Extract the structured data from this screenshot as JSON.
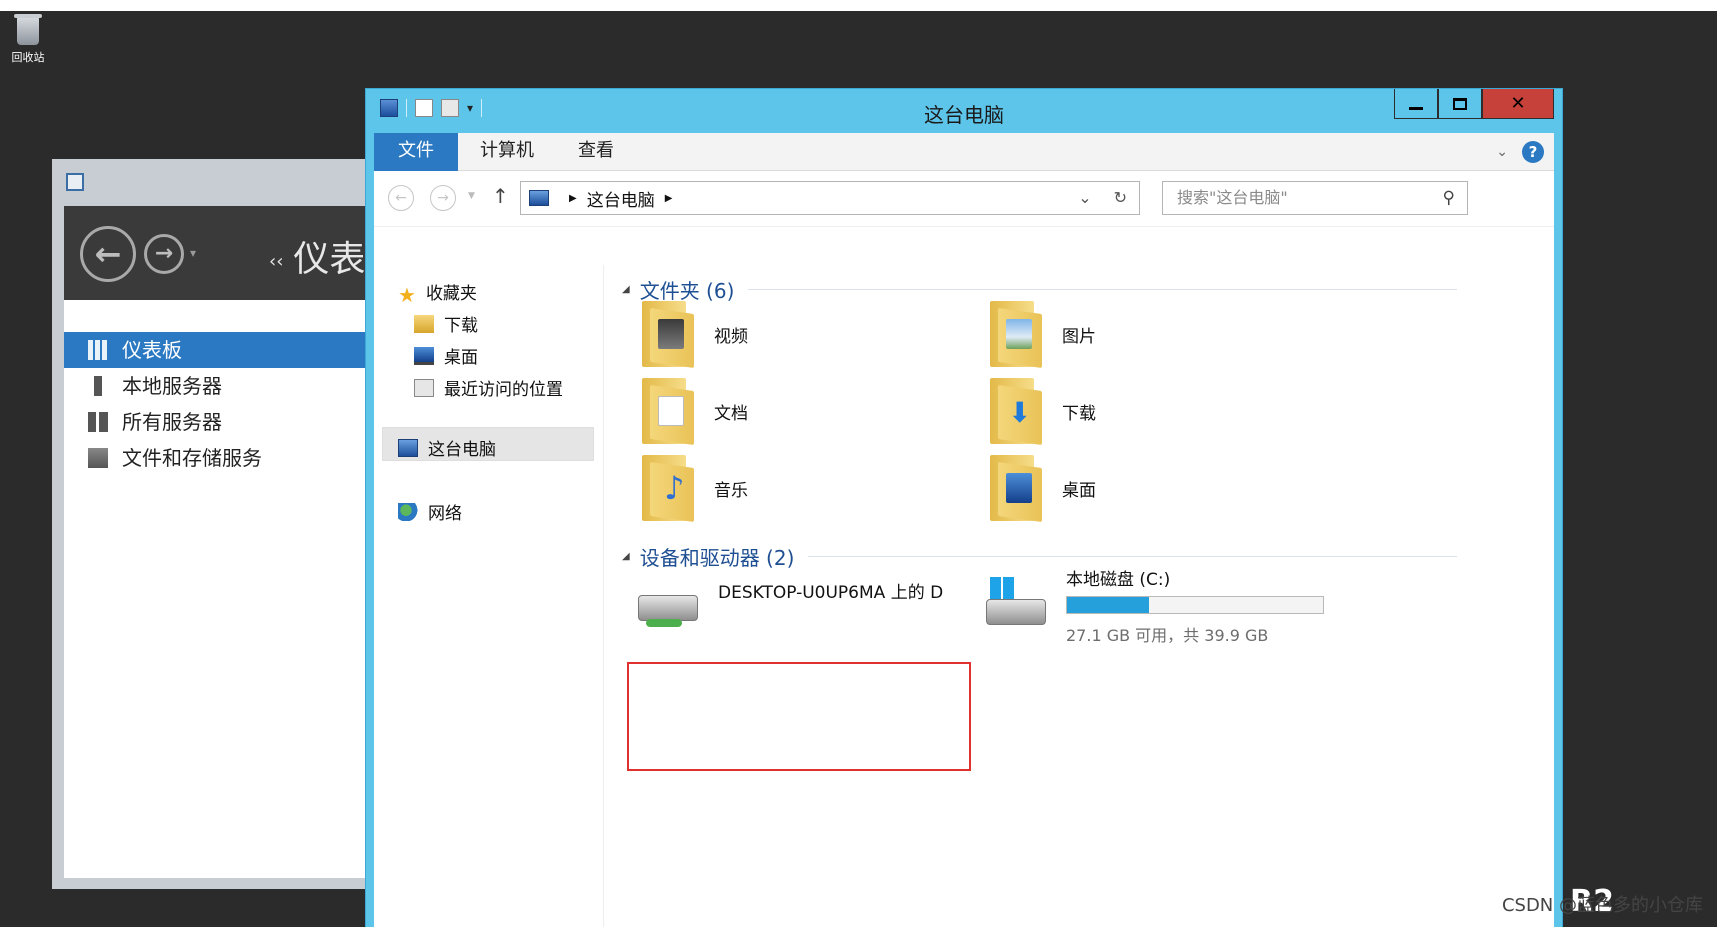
{
  "desktop": {
    "recycle_bin_label": "回收站",
    "corner_text": "R2"
  },
  "server_manager": {
    "breadcrumb": "仪表",
    "nav_arrows": "‹‹",
    "items": [
      {
        "label": "仪表板",
        "active": true
      },
      {
        "label": "本地服务器",
        "active": false
      },
      {
        "label": "所有服务器",
        "active": false
      },
      {
        "label": "文件和存储服务",
        "active": false
      }
    ]
  },
  "explorer": {
    "title": "这台电脑",
    "ribbon_tabs": [
      "文件",
      "计算机",
      "查看"
    ],
    "address": {
      "location": "这台电脑"
    },
    "search": {
      "placeholder": "搜索\"这台电脑\""
    },
    "nav_pane": {
      "favorites": "收藏夹",
      "downloads": "下载",
      "desktop": "桌面",
      "recent": "最近访问的位置",
      "this_pc": "这台电脑",
      "network": "网络"
    },
    "folders_group": "文件夹 (6)",
    "folders": [
      {
        "label": "视频",
        "icon": "video-folder-icon"
      },
      {
        "label": "图片",
        "icon": "pictures-folder-icon"
      },
      {
        "label": "文档",
        "icon": "documents-folder-icon"
      },
      {
        "label": "下载",
        "icon": "downloads-folder-icon"
      },
      {
        "label": "音乐",
        "icon": "music-folder-icon"
      },
      {
        "label": "桌面",
        "icon": "desktop-folder-icon"
      }
    ],
    "devices_group": "设备和驱动器 (2)",
    "network_drive": {
      "label": "DESKTOP-U0UP6MA 上的 D"
    },
    "local_disk": {
      "label": "本地磁盘 (C:)",
      "free_text": "27.1 GB 可用，共 39.9 GB",
      "used_fraction": 0.32
    },
    "colors": {
      "titlebar": "#5ec5ea",
      "accent": "#2b79c2",
      "close": "#c6413a",
      "highlight_box": "#e03131"
    }
  },
  "watermark": "CSDN @蓝色多的小仓库"
}
